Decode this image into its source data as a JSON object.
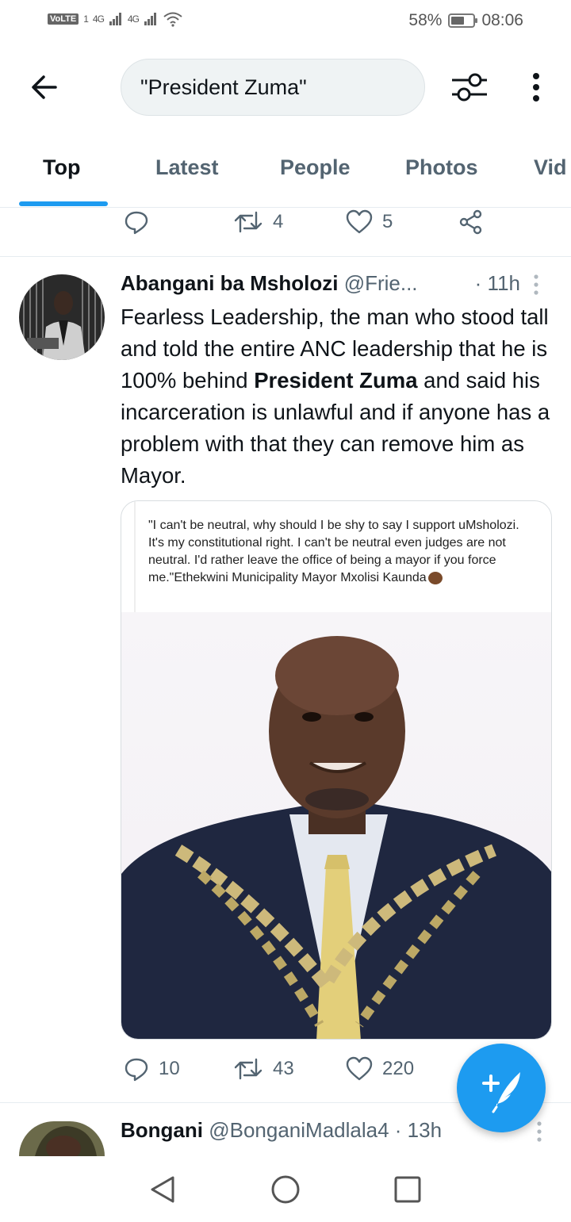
{
  "status_bar": {
    "volte": "VoLTE",
    "sim_indicator": "1",
    "signal_1": "4G",
    "signal_2": "4G",
    "battery_percent": "58%",
    "battery_level": 0.58,
    "time": "08:06"
  },
  "header": {
    "search_query": "\"President Zuma\""
  },
  "tabs": [
    {
      "label": "Top",
      "active": true
    },
    {
      "label": "Latest",
      "active": false
    },
    {
      "label": "People",
      "active": false
    },
    {
      "label": "Photos",
      "active": false
    },
    {
      "label": "Vid",
      "active": false
    }
  ],
  "previous_tweet": {
    "retweets": "4",
    "likes": "5"
  },
  "tweet": {
    "author": "Abangani ba Msholozi",
    "handle": "@Frie...",
    "time": "· 11h",
    "text_before": "Fearless Leadership, the man who stood tall and told the entire ANC leadership that he is 100% behind ",
    "text_bold": "President Zuma",
    "text_after": " and said his incarceration is unlawful and if anyone has a problem with that they can remove him as Mayor.",
    "media_quote": "\"I can't be neutral, why should I be shy to say I support uMsholozi. It's my constitutional right. I can't be neutral even judges are not neutral. I'd rather leave the office of being a mayor if you force me.\"Ethekwini Municipality Mayor Mxolisi Kaunda",
    "replies": "10",
    "retweets": "43",
    "likes": "220"
  },
  "next_tweet": {
    "author": "Bongani",
    "handle": "@BonganiMadlala4",
    "time": "· 13h"
  },
  "colors": {
    "accent": "#1d9bf0",
    "text_primary": "#0f1419",
    "text_secondary": "#536471"
  }
}
